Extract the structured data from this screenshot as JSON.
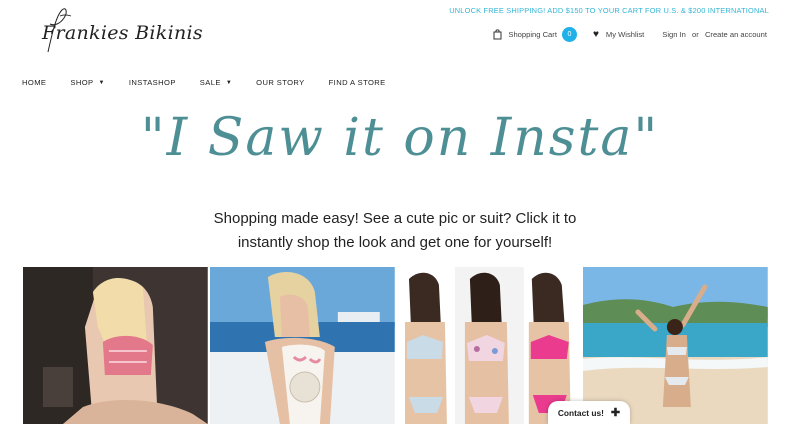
{
  "brand": {
    "logo_text": "Frankies Bikinis"
  },
  "promo": {
    "text": "UNLOCK FREE SHIPPING! ADD $150 TO YOUR CART FOR U.S. & $200 INTERNATIONAL"
  },
  "utility": {
    "cart_label": "Shopping Cart",
    "cart_count": "0",
    "wishlist_label": "My Wishlist",
    "signin_label": "Sign In",
    "or_text": "or",
    "create_account_label": "Create an account"
  },
  "nav": {
    "items": [
      {
        "label": "HOME"
      },
      {
        "label": "SHOP"
      },
      {
        "label": "INSTASHOP"
      },
      {
        "label": "SALE"
      },
      {
        "label": "OUR STORY"
      },
      {
        "label": "FIND A STORE"
      }
    ]
  },
  "hero": {
    "title": "\"I Saw it on Insta\"",
    "subtitle_line1": "Shopping made easy! See a cute pic or suit? Click it to",
    "subtitle_line2": "instantly shop the look and get one for yourself!"
  },
  "gallery": {
    "tiles": [
      {
        "icon": "photo-bikini-pink-halter"
      },
      {
        "icon": "photo-one-piece-boat"
      },
      {
        "icon": "photo-bikini-three-models"
      },
      {
        "icon": "photo-beach-bikini"
      }
    ]
  },
  "contact": {
    "label": "Contact us!",
    "icon": "plus-icon"
  },
  "colors": {
    "accent": "#33b5d6",
    "badge": "#1fb1e8",
    "title": "#4e8f95"
  }
}
